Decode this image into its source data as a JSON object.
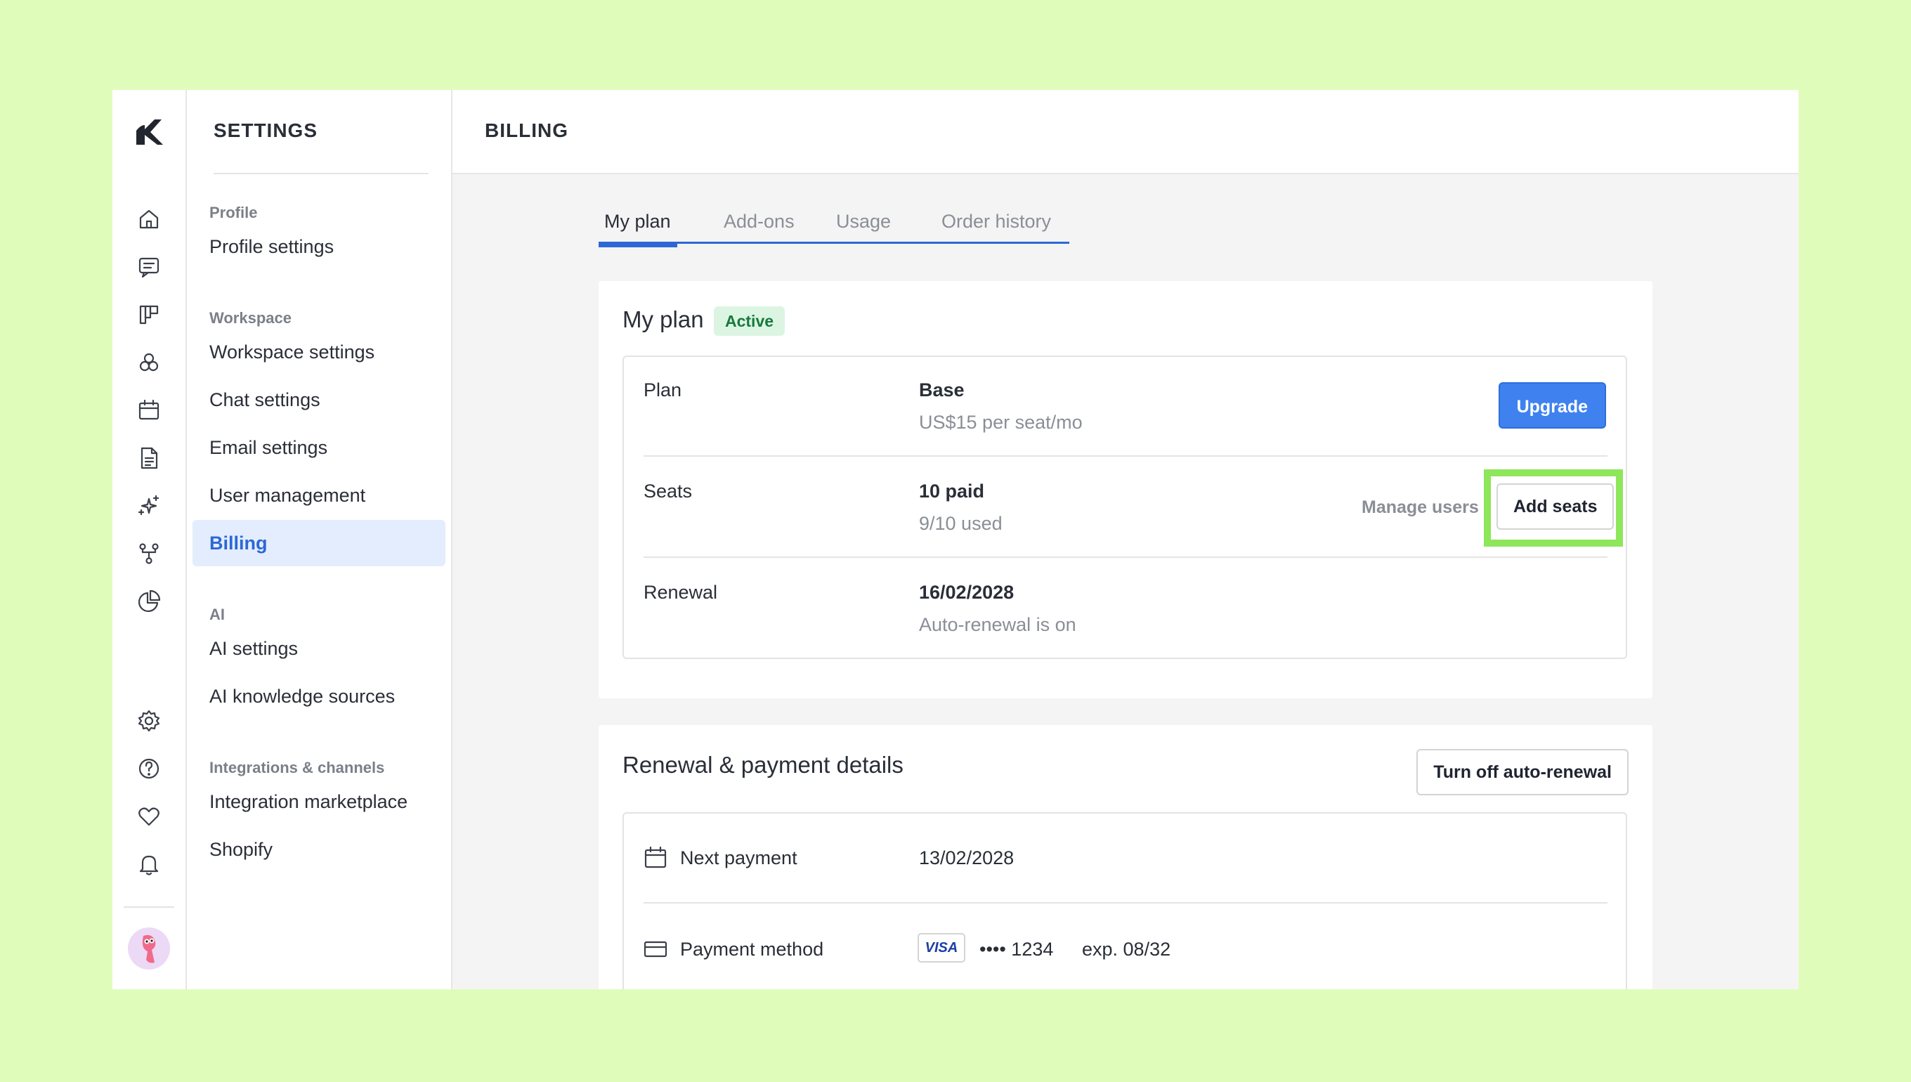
{
  "sidebar": {
    "title": "SETTINGS",
    "groups": [
      {
        "label": "Profile",
        "items": [
          "Profile settings"
        ]
      },
      {
        "label": "Workspace",
        "items": [
          "Workspace settings",
          "Chat settings",
          "Email settings",
          "User management",
          "Billing"
        ]
      },
      {
        "label": "AI",
        "items": [
          "AI settings",
          "AI knowledge sources"
        ]
      },
      {
        "label": "Integrations & channels",
        "items": [
          "Integration marketplace",
          "Shopify"
        ]
      }
    ],
    "active_item": "Billing"
  },
  "rail": {
    "icons": [
      "home-icon",
      "chat-icon",
      "board-icon",
      "circles-icon",
      "calendar-icon",
      "document-icon",
      "sparkles-icon",
      "workflow-icon",
      "pie-chart-icon",
      "settings-icon",
      "help-icon",
      "heart-icon",
      "bell-icon"
    ]
  },
  "header": {
    "title": "BILLING"
  },
  "tabs": [
    {
      "label": "My plan",
      "active": true
    },
    {
      "label": "Add-ons",
      "active": false
    },
    {
      "label": "Usage",
      "active": false
    },
    {
      "label": "Order history",
      "active": false
    }
  ],
  "plan_card": {
    "title": "My plan",
    "status": "Active",
    "plan": {
      "label": "Plan",
      "value": "Base",
      "sub": "US$15 per seat/mo",
      "action": "Upgrade"
    },
    "seats": {
      "label": "Seats",
      "value": "10 paid",
      "sub": "9/10 used",
      "link": "Manage users",
      "action": "Add seats"
    },
    "renewal": {
      "label": "Renewal",
      "value": "16/02/2028",
      "sub": "Auto-renewal is on"
    }
  },
  "payment_card": {
    "title": "Renewal & payment details",
    "action": "Turn off auto-renewal",
    "next_payment": {
      "label": "Next payment",
      "value": "13/02/2028"
    },
    "payment_method": {
      "label": "Payment method",
      "brand": "VISA",
      "masked": "•••• 1234",
      "exp": "exp. 08/32"
    }
  },
  "colors": {
    "background": "#e0fcbb",
    "accent": "#3f82ef",
    "active_nav_bg": "#e3edfd",
    "highlight": "#8ee65a",
    "badge_bg": "#dcf5e3",
    "badge_text": "#177a3b"
  }
}
